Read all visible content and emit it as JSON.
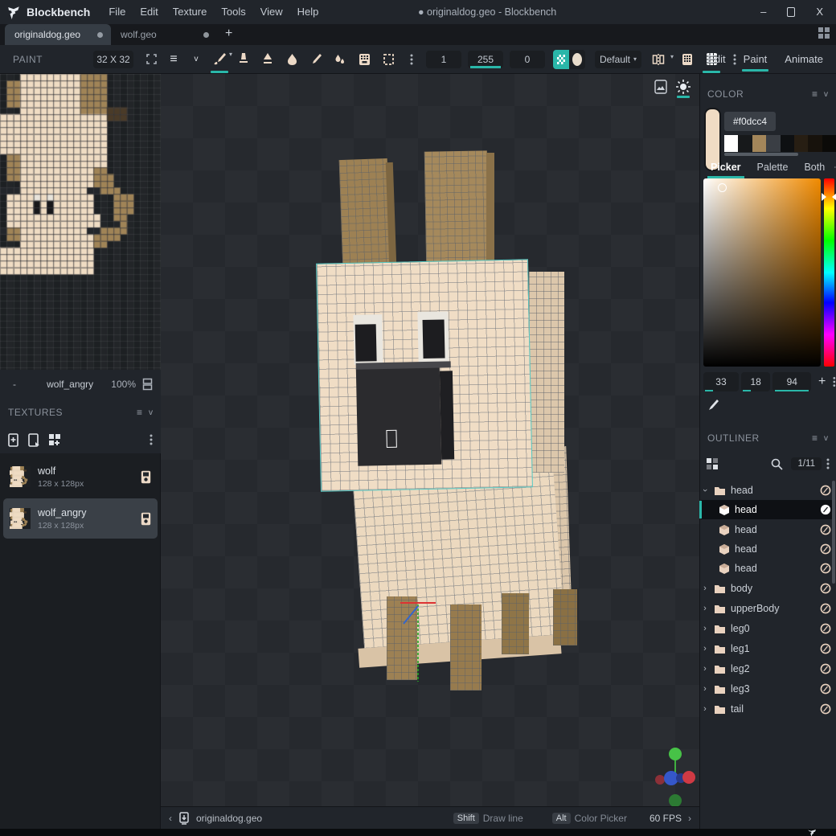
{
  "colors": {
    "accent": "#2ab7a9",
    "cream": "#f0dcc4",
    "tan": "#a08457",
    "panel": "#21252b",
    "dark": "#17191d",
    "viewport_bg": "#26292e",
    "muzzle": "#2b2b2e",
    "selection_teal": "#57c9c4"
  },
  "titlebar": {
    "app_name": "Blockbench",
    "menus": [
      "File",
      "Edit",
      "Texture",
      "Tools",
      "View",
      "Help"
    ],
    "window_title": "● originaldog.geo - Blockbench",
    "minimize": "–",
    "close": "X"
  },
  "tabs": {
    "items": [
      {
        "label": "originaldog.geo",
        "active": true
      },
      {
        "label": "wolf.geo",
        "active": false
      }
    ],
    "new_tab": "+"
  },
  "toolbar": {
    "panel_label": "PAINT",
    "size_label": "32 X 32",
    "brush_size": "1",
    "opacity": "255",
    "softness": "0",
    "shape_dropdown": "Default",
    "modes": [
      {
        "label": "Edit"
      },
      {
        "label": "Paint"
      },
      {
        "label": "Animate"
      }
    ]
  },
  "uv_panel": {
    "minus": "-",
    "texture_name": "wolf_angry",
    "zoom": "100%",
    "pixel_palette": {
      "c": "#efdcc3",
      "b": "#a08457",
      "d": "#4a3b28",
      "k": "#17171a",
      "w": "#e7e3da",
      "n": "#23262b"
    },
    "pixel_rows": [
      "...cccccccccbbbb........",
      ".bbcccccccccbbbb........",
      ".bbcccccccccbbbb........",
      ".bbcccccccccbbbb........",
      ".bbcccccccccbbbb........",
      "...cccccccccbbbbddd.....",
      "ccccccccccccccccddd.....",
      "cccccccccccccccc........",
      "cccccccccccccccc........",
      "cccccccccccccccc........",
      "cccccccccccccccc........",
      "cccccccccccccccc........",
      ".bbccccccccccccc........",
      ".bbccccccccccccc........",
      ".bbcccccccccccbb........",
      ".bbcccccccccccbbb.......",
      "...cccccccccccbbb.......",
      "nnnccccccccccnnbbb......",
      ".ccccwcwcccccc...bbb....",
      ".cccckckcccccc...bbb....",
      ".cccckckcccccc...bbb....",
      ".cccccccccccccc..bb.....",
      ".cccccccccccccc...b.....",
      "nbbccccccccccnnbbbb.....",
      ".bbcccccccccccbbbb......",
      "...cccccccccccbb........",
      "cccccccccccccc..........",
      "cccccccccccccc..........",
      "cccccccccccccc..........",
      "cccccccccccccc..........",
      "........................",
      "........................"
    ]
  },
  "textures_panel": {
    "title": "TEXTURES",
    "items": [
      {
        "name": "wolf",
        "size": "128 x 128px",
        "selected": false
      },
      {
        "name": "wolf_angry",
        "size": "128 x 128px",
        "selected": true
      }
    ]
  },
  "color_panel": {
    "title": "COLOR",
    "hex": "#f0dcc4",
    "history": [
      "#ffffff",
      "#17191b",
      "#a3865a",
      "#3a3e44",
      "#0e1012",
      "#271e13",
      "#17120c",
      "#0b0a08"
    ],
    "tabs": [
      {
        "label": "Picker",
        "active": true
      },
      {
        "label": "Palette",
        "active": false
      },
      {
        "label": "Both",
        "active": false
      }
    ],
    "values": [
      "33",
      "18",
      "94"
    ],
    "add": "+"
  },
  "outliner": {
    "title": "OUTLINER",
    "count": "1/11",
    "rows": [
      {
        "label": "head",
        "kind": "group",
        "expanded": true,
        "selected": false
      },
      {
        "label": "head",
        "kind": "cube",
        "selected": true
      },
      {
        "label": "head",
        "kind": "cube",
        "selected": false
      },
      {
        "label": "head",
        "kind": "cube",
        "selected": false
      },
      {
        "label": "head",
        "kind": "cube",
        "selected": false
      },
      {
        "label": "body",
        "kind": "group",
        "expanded": false
      },
      {
        "label": "upperBody",
        "kind": "group",
        "expanded": false
      },
      {
        "label": "leg0",
        "kind": "group",
        "expanded": false
      },
      {
        "label": "leg1",
        "kind": "group",
        "expanded": false
      },
      {
        "label": "leg2",
        "kind": "group",
        "expanded": false
      },
      {
        "label": "leg3",
        "kind": "group",
        "expanded": false
      },
      {
        "label": "tail",
        "kind": "group",
        "expanded": false
      }
    ]
  },
  "statusbar": {
    "file": "originaldog.geo",
    "hints": [
      {
        "key": "Shift",
        "action": "Draw line"
      },
      {
        "key": "Alt",
        "action": "Color Picker"
      }
    ],
    "fps": "60 FPS"
  }
}
